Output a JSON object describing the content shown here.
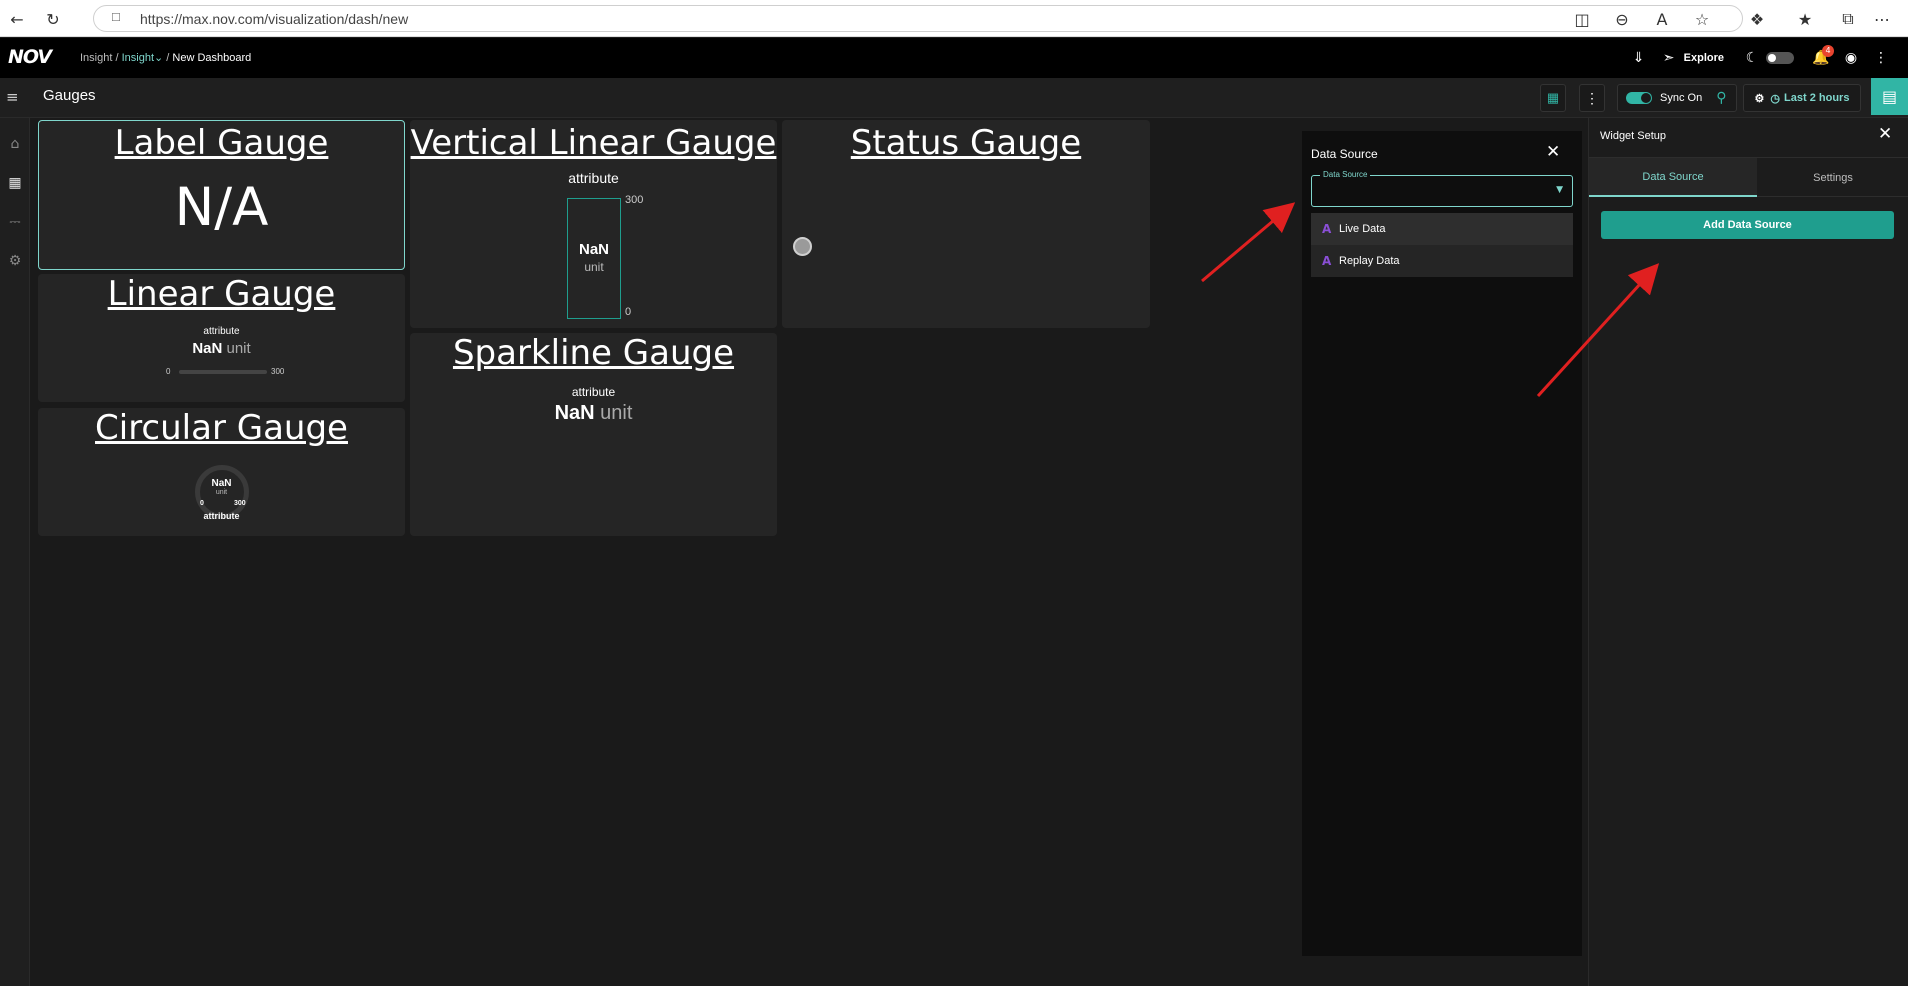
{
  "browser": {
    "url": "https://max.nov.com/visualization/dash/new"
  },
  "app": {
    "logo": "NOV",
    "breadcrumb": {
      "part1": "Insight",
      "sep1": " / ",
      "part2": "Insight",
      "sep2": " / ",
      "current": "New Dashboard"
    },
    "explore_label": "Explore",
    "notification_count": "4"
  },
  "toolbar": {
    "page_title": "Gauges",
    "sync_label": "Sync On",
    "time_range_label": "Last 2 hours"
  },
  "gauges": {
    "label_gauge": {
      "title": "Label Gauge",
      "value": "N/A"
    },
    "vertical_linear": {
      "title": "Vertical Linear Gauge",
      "attribute": "attribute",
      "max": "300",
      "min": "0",
      "value": "NaN",
      "unit": "unit"
    },
    "status_gauge": {
      "title": "Status Gauge"
    },
    "linear_gauge": {
      "title": "Linear Gauge",
      "attribute": "attribute",
      "value": "NaN",
      "unit": "unit",
      "min": "0",
      "max": "300"
    },
    "sparkline_gauge": {
      "title": "Sparkline Gauge",
      "attribute": "attribute",
      "value": "NaN",
      "unit": "unit"
    },
    "circular_gauge": {
      "title": "Circular Gauge",
      "value": "NaN",
      "unit": "unit",
      "min": "0",
      "max": "300",
      "attribute": "attribute"
    }
  },
  "data_source_panel": {
    "title": "Data Source",
    "field_label": "Data Source",
    "options": [
      "Live Data",
      "Replay Data"
    ]
  },
  "widget_setup": {
    "title": "Widget Setup",
    "tabs": [
      "Data Source",
      "Settings"
    ],
    "add_button": "Add Data Source"
  },
  "colors": {
    "accent": "#31b5a5",
    "annotation": "#e02020",
    "option_icon": "#8a4fd6"
  },
  "icons": [
    "back-icon",
    "refresh-icon",
    "lock-icon",
    "home-icon",
    "dashboard-icon",
    "bell-icon",
    "gear-icon",
    "close-icon",
    "save-icon",
    "kebab-icon",
    "search-icon",
    "clock-icon",
    "compass-icon",
    "headset-icon"
  ]
}
